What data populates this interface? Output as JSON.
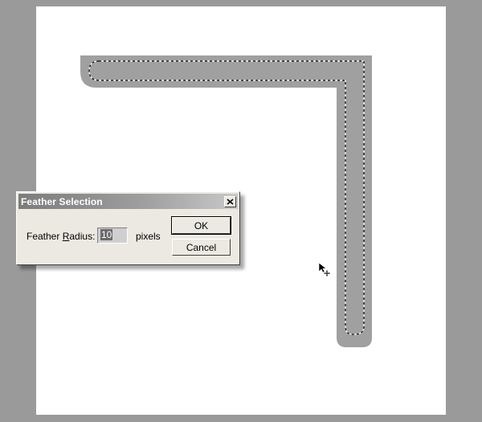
{
  "dialog": {
    "title": "Feather Selection",
    "field_label_prefix": "Feather ",
    "field_label_mnemonic": "R",
    "field_label_suffix": "adius:",
    "radius_value": "10",
    "unit": "pixels",
    "ok_label": "OK",
    "cancel_label": "Cancel",
    "close_icon": "close-icon"
  },
  "canvas": {
    "background": "#ffffff",
    "shape_color": "#a0a0a0",
    "workspace_color": "#9a9a9a"
  },
  "cursor": {
    "icon": "move-arrow-cursor-icon"
  }
}
